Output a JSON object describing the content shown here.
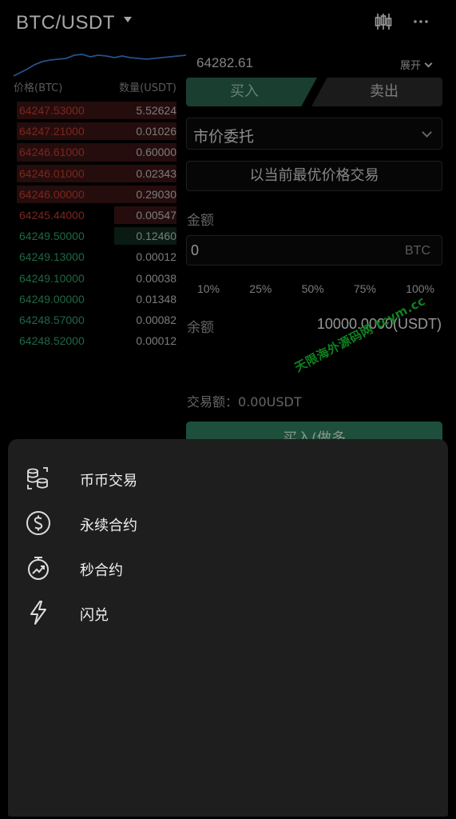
{
  "header": {
    "pair": "BTC/USDT",
    "candle_icon": "candlestick-icon",
    "more_icon": "more-dots-icon"
  },
  "orderbook": {
    "price_header": "价格(BTC)",
    "qty_header": "数量(USDT)",
    "asks": [
      {
        "price": "64247.53000",
        "qty": "5.52624",
        "depth": 0.98
      },
      {
        "price": "64247.21000",
        "qty": "0.01026",
        "depth": 0.98
      },
      {
        "price": "64246.61000",
        "qty": "0.60000",
        "depth": 0.98
      },
      {
        "price": "64246.01000",
        "qty": "0.02343",
        "depth": 0.98
      },
      {
        "price": "64246.00000",
        "qty": "0.29030",
        "depth": 0.98
      },
      {
        "price": "64245.44000",
        "qty": "0.00547",
        "depth": 0.38
      }
    ],
    "bids": [
      {
        "price": "64249.50000",
        "qty": "0.12460",
        "depth": 0.38
      },
      {
        "price": "64249.13000",
        "qty": "0.00012",
        "depth": 0
      },
      {
        "price": "64249.10000",
        "qty": "0.00038",
        "depth": 0
      },
      {
        "price": "64249.00000",
        "qty": "0.01348",
        "depth": 0
      },
      {
        "price": "64248.57000",
        "qty": "0.00082",
        "depth": 0
      },
      {
        "price": "64248.52000",
        "qty": "0.00012",
        "depth": 0
      }
    ]
  },
  "trade": {
    "last_price": "64282.61",
    "expand_label": "展开",
    "buy_tab": "买入",
    "sell_tab": "卖出",
    "order_type": "市价委托",
    "best_price_label": "以当前最优价格交易",
    "amount_label": "金额",
    "amount_value": "0",
    "amount_unit": "BTC",
    "percents": [
      "10%",
      "25%",
      "50%",
      "75%",
      "100%"
    ],
    "balance_label": "余额",
    "balance_value": "10000.0000(USDT)",
    "trade_amount_label": "交易额：",
    "trade_amount_value": "0.00USDT",
    "submit_label": "买入(做多"
  },
  "watermark": "天限海外源码网 tcym.cc",
  "menu": {
    "items": [
      {
        "label": "币币交易",
        "icon": "coins-exchange-icon"
      },
      {
        "label": "永续合约",
        "icon": "dollar-circle-icon"
      },
      {
        "label": "秒合约",
        "icon": "stopwatch-trend-icon"
      },
      {
        "label": "闪兑",
        "icon": "lightning-icon"
      }
    ]
  },
  "colors": {
    "ask": "#c0392b",
    "bid": "#2f9e6b",
    "buy_accent": "#28604a",
    "sheet_bg": "#1e1e1e"
  }
}
